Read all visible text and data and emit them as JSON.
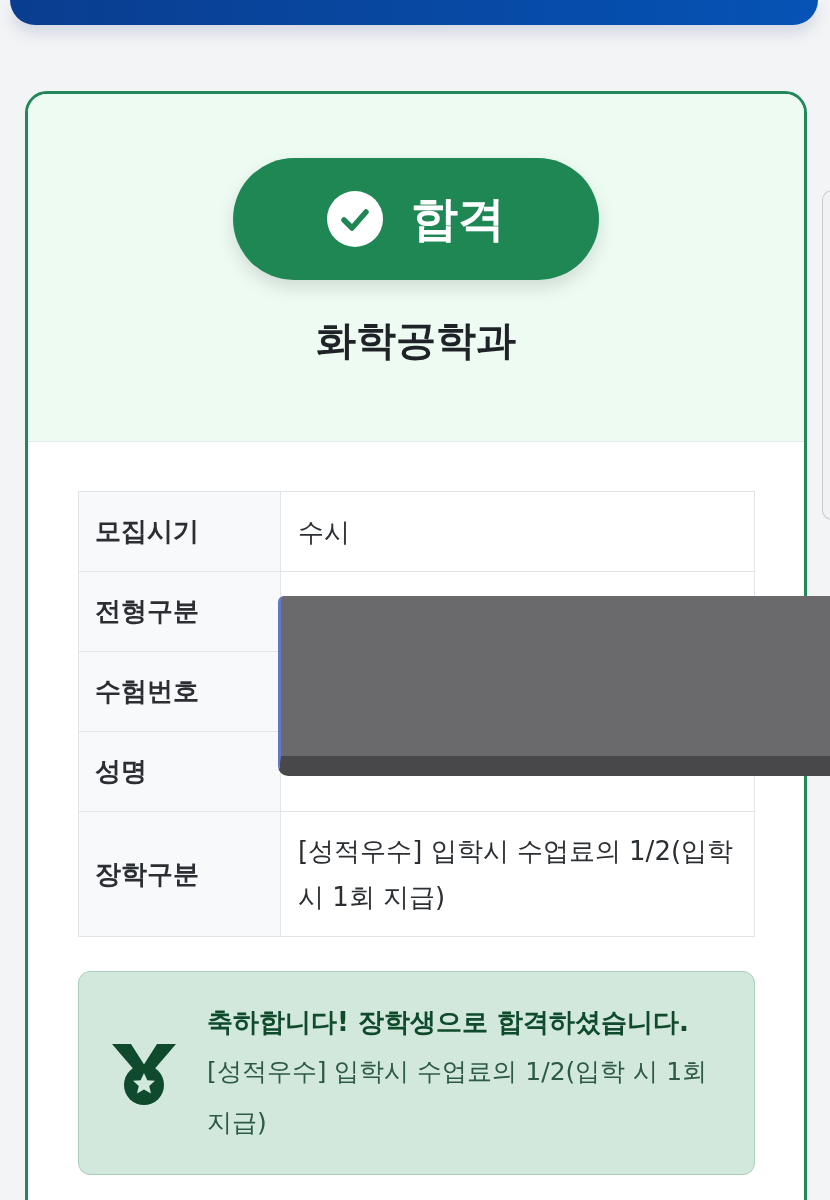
{
  "result": {
    "status": {
      "label": "합격"
    },
    "department": "화학공학과"
  },
  "info_table": {
    "rows": [
      {
        "label": "모집시기",
        "value": "수시"
      },
      {
        "label": "전형구분"
      },
      {
        "label": "수험번호"
      },
      {
        "label": "성명"
      },
      {
        "label": "장학구분",
        "value": "[성적우수] 입학시 수업료의 1/2(입학 시 1회 지급)"
      }
    ]
  },
  "scholarship_notice": {
    "title": "축하합니다! 장학생으로 합격하셨습니다.",
    "text": "[성적우수] 입학시 수업료의 1/2(입학 시 1회 지급)"
  }
}
